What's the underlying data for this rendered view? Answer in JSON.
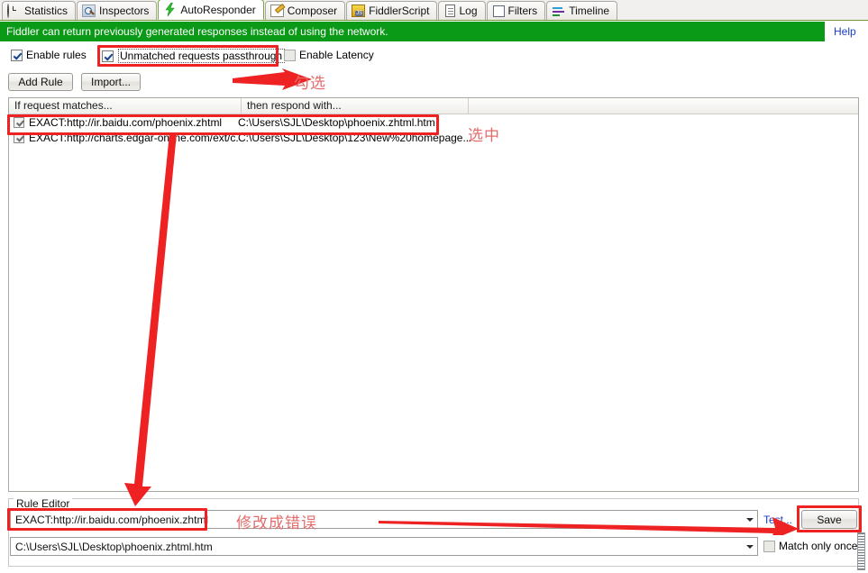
{
  "tabs": [
    {
      "label": "Statistics",
      "icon": "clock-icon",
      "active": false
    },
    {
      "label": "Inspectors",
      "icon": "magnifier-icon",
      "active": false
    },
    {
      "label": "AutoResponder",
      "icon": "bolt-icon",
      "active": true
    },
    {
      "label": "Composer",
      "icon": "pencil-icon",
      "active": false
    },
    {
      "label": "FiddlerScript",
      "icon": "js-script-icon",
      "active": false
    },
    {
      "label": "Log",
      "icon": "document-icon",
      "active": false
    },
    {
      "label": "Filters",
      "icon": "square-icon",
      "active": false
    },
    {
      "label": "Timeline",
      "icon": "timeline-icon",
      "active": false
    }
  ],
  "banner": {
    "text": "Fiddler can return previously generated responses instead of using the network.",
    "help_label": "Help",
    "background": "#0a9a17"
  },
  "options": {
    "enable_rules": {
      "label": "Enable rules",
      "checked": true
    },
    "unmatched_passthrough": {
      "label": "Unmatched requests passthrough",
      "checked": true,
      "focused": true
    },
    "enable_latency": {
      "label": "Enable Latency",
      "checked": false
    }
  },
  "toolbar": {
    "add_rule_label": "Add Rule",
    "import_label": "Import..."
  },
  "list": {
    "headers": [
      "If request matches...",
      "then respond with...",
      ""
    ],
    "rows": [
      {
        "checked": true,
        "match": "EXACT:http://ir.baidu.com/phoenix.zhtml",
        "respond": "C:\\Users\\SJL\\Desktop\\phoenix.zhtml.htm"
      },
      {
        "checked": true,
        "match": "EXACT:http://charts.edgar-online.com/ext/c...",
        "respond": "C:\\Users\\SJL\\Desktop\\123\\New%20homepage..."
      }
    ]
  },
  "rule_editor": {
    "title": "Rule Editor",
    "match_value": "EXACT:http://ir.baidu.com/phoenix.zhtml",
    "respond_value": "C:\\Users\\SJL\\Desktop\\phoenix.zhtml.htm",
    "test_label": "Test...",
    "save_label": "Save",
    "match_only_once": {
      "label": "Match only once",
      "checked": false
    }
  },
  "annotations": {
    "accent_color": "#ee2222",
    "text_color": "#e46b6b",
    "notes": [
      {
        "text": "勾选",
        "meaning": "check-this"
      },
      {
        "text": "选中",
        "meaning": "select-this"
      },
      {
        "text": "修改成错误",
        "meaning": "change-to-wrong-value"
      }
    ]
  }
}
